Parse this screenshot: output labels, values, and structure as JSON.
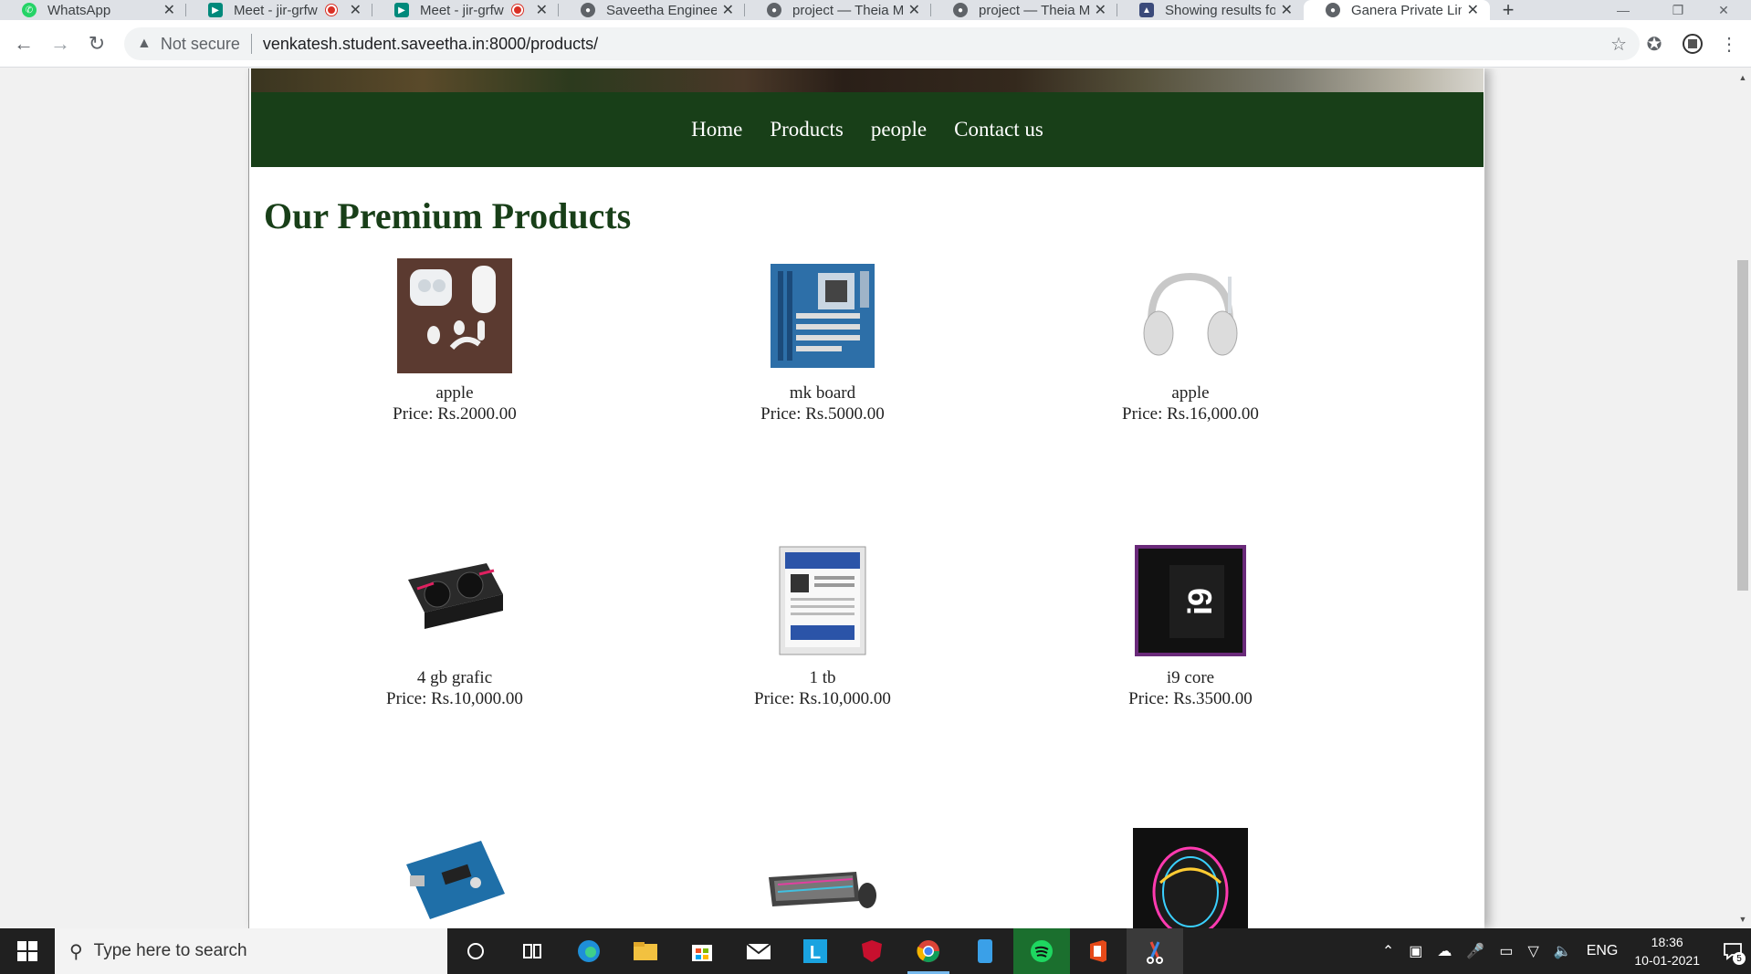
{
  "browser": {
    "tabs": [
      {
        "title": "WhatsApp",
        "icon": "whatsapp-icon",
        "recording": false,
        "active": false
      },
      {
        "title": "Meet - jir-grfw",
        "icon": "google-meet-icon",
        "recording": true,
        "active": false
      },
      {
        "title": "Meet - jir-grfw",
        "icon": "google-meet-icon",
        "recording": true,
        "active": false
      },
      {
        "title": "Saveetha Engineer",
        "icon": "globe-icon",
        "recording": false,
        "active": false
      },
      {
        "title": "project — Theia M",
        "icon": "globe-icon",
        "recording": false,
        "active": false
      },
      {
        "title": "project — Theia M",
        "icon": "globe-icon",
        "recording": false,
        "active": false
      },
      {
        "title": "Showing results fo",
        "icon": "site-icon",
        "recording": false,
        "active": false
      },
      {
        "title": "Ganera Private Lim",
        "icon": "globe-icon",
        "recording": false,
        "active": true
      }
    ],
    "new_tab_label": "+",
    "security_label": "Not secure",
    "url": "venkatesh.student.saveetha.in:8000/products/"
  },
  "site": {
    "nav": [
      "Home",
      "Products",
      "people",
      "Contact us"
    ],
    "heading": "Our Premium Products",
    "products": [
      {
        "name": "apple",
        "price": "Price: Rs.2000.00",
        "image": "earbuds-image"
      },
      {
        "name": "mk board",
        "price": "Price: Rs.5000.00",
        "image": "motherboard-image"
      },
      {
        "name": "apple",
        "price": "Price: Rs.16,000.00",
        "image": "headphones-image"
      },
      {
        "name": "4 gb grafic",
        "price": "Price: Rs.10,000.00",
        "image": "graphics-card-image"
      },
      {
        "name": "1 tb",
        "price": "Price: Rs.10,000.00",
        "image": "hard-drive-image"
      },
      {
        "name": "i9 core",
        "price": "Price: Rs.3500.00",
        "image": "cpu-box-image"
      },
      {
        "name": "",
        "price": "",
        "image": "arduino-board-image"
      },
      {
        "name": "",
        "price": "",
        "image": "keyboard-mouse-image"
      },
      {
        "name": "",
        "price": "",
        "image": "gaming-mouse-image"
      }
    ],
    "colors": {
      "nav_bg": "#183f18",
      "heading": "#183f18"
    }
  },
  "taskbar": {
    "search_placeholder": "Type here to search",
    "language": "ENG",
    "time": "18:36",
    "date": "10-01-2021",
    "notification_count": "5"
  }
}
